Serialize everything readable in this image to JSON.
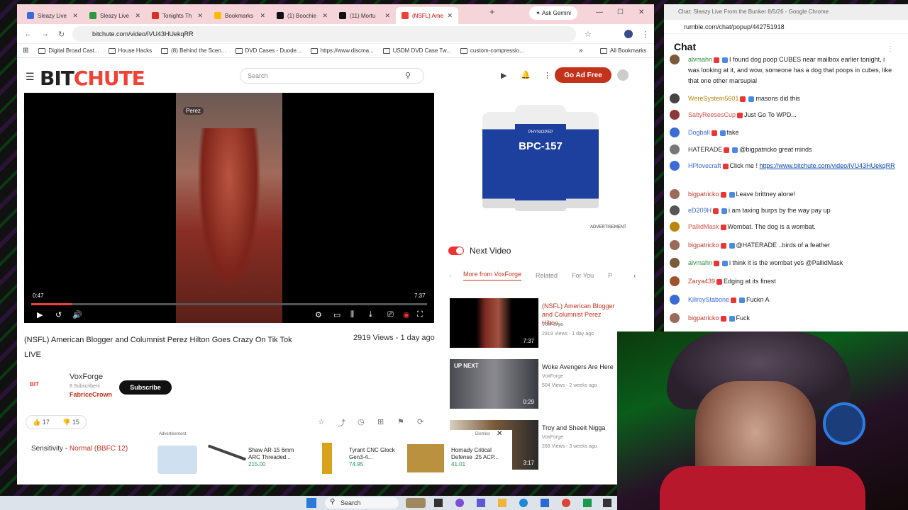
{
  "browser": {
    "tabs": [
      {
        "label": "Sleazy Live",
        "color": "#3b6cd6"
      },
      {
        "label": "Sleazy Live",
        "color": "#2b9a3f"
      },
      {
        "label": "Tonights Th",
        "color": "#d93025"
      },
      {
        "label": "Bookmarks",
        "color": "#fbbc05"
      },
      {
        "label": "(1) Boochie",
        "color": "#111111"
      },
      {
        "label": "(11) Mortu",
        "color": "#111111"
      },
      {
        "label": "(NSFL) Ame",
        "color": "#ef4136"
      }
    ],
    "ask_gemini": "Ask Gemini",
    "url": "bitchute.com/video/iVU43HUekqRR",
    "bookmarks": [
      "Digital Broad Cast...",
      "House Hacks",
      "(8) Behind the Scen...",
      "DVD Cases - Duode...",
      "https://www.discma...",
      "USDM DVD Case Tw...",
      "custom-compressio..."
    ],
    "all_bookmarks": "All Bookmarks"
  },
  "site": {
    "logo_a": "BIT",
    "logo_b": "CHUTE",
    "search_placeholder": "Search",
    "go_ad_free": "Go Ad Free"
  },
  "video": {
    "tag": "Perez",
    "time_current": "0:47",
    "time_total": "7:37",
    "progress": 0.103,
    "title": "(NSFL) American Blogger and Columnist Perez Hilton Goes Crazy On Tik Tok LIVE",
    "views": "2919 Views - 1 day ago",
    "channel": "VoxForge",
    "subscribers": "8 Subscribers",
    "owner": "FabriceCrown",
    "subscribe": "Subscribe",
    "likes": "17",
    "dislikes": "15",
    "sensitivity_label": "Sensitivity - ",
    "sensitivity_value": "Normal (BBFC 12)"
  },
  "ad": {
    "product": "BPC-157",
    "brand": "PHYSIOPEP",
    "advertisement": "ADVERTISEMENT",
    "strip_label": "Advertisement",
    "dismiss": "Dismiss",
    "items": [
      {
        "name": "Shaw AR-15 6mm ARC Threaded...",
        "price": "215.00"
      },
      {
        "name": "Tyrant CNC Glock Gen3-4...",
        "price": "74.95"
      },
      {
        "name": "Hornady Critical Defense .25 ACP...",
        "price": "41.01"
      }
    ]
  },
  "next_video": {
    "heading": "Next Video",
    "tabs": [
      "More from VoxForge",
      "Related",
      "For You",
      "P"
    ],
    "cards": [
      {
        "title": "(NSFL) American Blogger and Columnist Perez Hilton...",
        "author": "VoxForge",
        "meta": "2919 Views - 1 day ago",
        "duration": "7:37",
        "badge": ""
      },
      {
        "title": "Woke Avengers Are Here",
        "author": "VoxForge",
        "meta": "504 Views - 2 weeks ago",
        "duration": "0:29",
        "badge": "UP NEXT"
      },
      {
        "title": "Troy and Sheeit Nigga",
        "author": "VoxForge",
        "meta": "268 Views - 3 weeks ago",
        "duration": "3:17",
        "badge": ""
      }
    ]
  },
  "chat": {
    "window_title": "Chat: Sleazy Live From the Bunker 8/5/26 - Google Chrome",
    "url": "rumble.com/chat/popup/442751918",
    "heading": "Chat",
    "messages": [
      {
        "user": "alvmahn",
        "color": "#2d8c3c",
        "text": "I found dog poop CUBES near mailbox earlier tonight, i was looking at it, and wow, someone has a dog that poops in cubes, like that one other marsupial",
        "avatar": "#7a5a3a"
      },
      {
        "user": "WereSystem5601",
        "color": "#b8860b",
        "text": "masons did this",
        "avatar": "#444444"
      },
      {
        "user": "SaltyReesesCup",
        "color": "#d9534f",
        "text": "Just Go To WPD...",
        "avatar": "#8a3a3a"
      },
      {
        "user": "Dogball",
        "color": "#3b6cd6",
        "text": "fake",
        "avatar": "#3b6cd6"
      },
      {
        "user": "HATERADE",
        "color": "#333333",
        "text": "@bigpatricko great minds",
        "avatar": "#777777"
      },
      {
        "user": "HPlovecraft",
        "color": "#3b6cd6",
        "text": "Click me ! ",
        "link": "https://www.bitchute.com/video/iVU43HUekqRR",
        "avatar": "#3b6cd6"
      },
      {
        "user": "bigpatricko",
        "color": "#c0392b",
        "text": "Leave brittney alone!",
        "avatar": "#9a6a5a"
      },
      {
        "user": "eD209H",
        "color": "#3b6cd6",
        "text": "i am taxing burps by the way pay up",
        "avatar": "#555555"
      },
      {
        "user": "PallidMask",
        "color": "#d9534f",
        "text": "Wombat. The dog is a wombat.",
        "avatar": "#b8860b"
      },
      {
        "user": "bigpatricko",
        "color": "#c0392b",
        "text": "@HATERADE ..birds of a feather",
        "avatar": "#9a6a5a"
      },
      {
        "user": "alvmahn",
        "color": "#2d8c3c",
        "text": "i think it is the wombat yes @PallidMask",
        "avatar": "#7a5a3a"
      },
      {
        "user": "Zarya439",
        "color": "#c0392b",
        "text": "Edging at its finest",
        "avatar": "#a0522d"
      },
      {
        "user": "KillroyStabone",
        "color": "#3b6cd6",
        "text": "Fuckn A",
        "avatar": "#3b6cd6"
      },
      {
        "user": "bigpatricko",
        "color": "#c0392b",
        "text": "Fuck",
        "avatar": "#9a6a5a"
      }
    ]
  },
  "taskbar": {
    "search": "Search"
  }
}
